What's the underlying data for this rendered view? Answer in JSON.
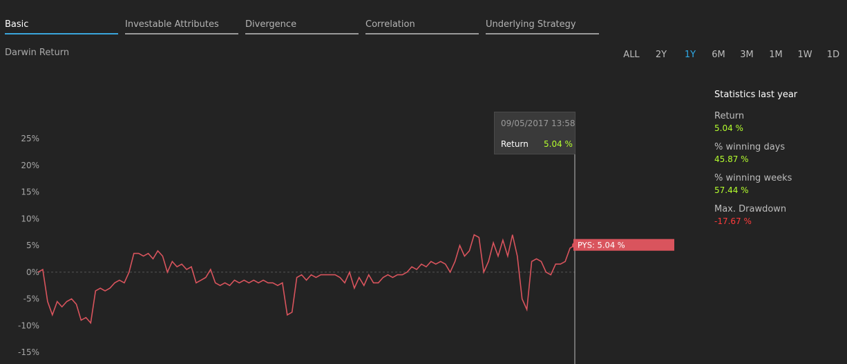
{
  "tabs": [
    {
      "label": "Basic",
      "active": true
    },
    {
      "label": "Investable Attributes",
      "active": false
    },
    {
      "label": "Divergence",
      "active": false
    },
    {
      "label": "Correlation",
      "active": false
    },
    {
      "label": "Underlying Strategy",
      "active": false
    }
  ],
  "section_title": "Darwin Return",
  "periods": [
    {
      "label": "ALL",
      "active": false
    },
    {
      "label": "2Y",
      "active": false
    },
    {
      "label": "1Y",
      "active": true
    },
    {
      "label": "6M",
      "active": false
    },
    {
      "label": "3M",
      "active": false
    },
    {
      "label": "1M",
      "active": false
    },
    {
      "label": "1W",
      "active": false
    },
    {
      "label": "1D",
      "active": false
    }
  ],
  "tooltip": {
    "date": "09/05/2017 13:58",
    "label": "Return",
    "value": "5.04 %"
  },
  "stats": {
    "title": "Statistics last year",
    "items": [
      {
        "label": "Return",
        "value": "5.04 %",
        "sign": "pos"
      },
      {
        "label": "% winning days",
        "value": "45.87 %",
        "sign": "pos"
      },
      {
        "label": "% winning weeks",
        "value": "57.44 %",
        "sign": "pos"
      },
      {
        "label": "Max. Drawdown",
        "value": "-17.67 %",
        "sign": "neg"
      }
    ]
  },
  "colors": {
    "line": "#d9545d",
    "accent": "#2fa9e6",
    "positive": "#b5ff2e",
    "negative": "#ff3b3b"
  },
  "chart_data": {
    "type": "line",
    "ylabel_ticks": [
      "25%",
      "20%",
      "15%",
      "10%",
      "5%",
      "0%",
      "-5%",
      "-10%",
      "-15%"
    ],
    "ylim": [
      -15,
      25
    ],
    "end_label": "PYS: 5.04 %",
    "series": [
      {
        "values": [
          0,
          0.5,
          -5.5,
          -8,
          -5.5,
          -6.5,
          -5.5,
          -5.0,
          -6,
          -9,
          -8.5,
          -9.5,
          -3.5,
          -3,
          -3.5,
          -3.0,
          -2,
          -1.5,
          -2,
          0,
          3.5,
          3.5,
          3,
          3.5,
          2.5,
          4,
          3,
          0,
          2.0,
          1,
          1.5,
          0.5,
          1,
          -2,
          -1.5,
          -1,
          0.5,
          -2,
          -2.5,
          -2,
          -2.5,
          -1.5,
          -2,
          -1.5,
          -2,
          -1.5,
          -2,
          -1.5,
          -2.0,
          -2,
          -2.5,
          -2,
          -8,
          -7.5,
          -1,
          -0.5,
          -1.5,
          -0.5,
          -1,
          -0.5,
          -0.5,
          -0.5,
          -0.5,
          -1,
          -2,
          0,
          -3,
          -1,
          -2.5,
          -0.5,
          -2,
          -2,
          -1,
          -0.5,
          -1,
          -0.5,
          -0.5,
          0,
          1,
          0.5,
          1.5,
          1,
          2,
          1.5,
          2,
          1.5,
          0,
          2,
          5,
          3,
          4,
          7,
          6.5,
          0,
          2,
          5.5,
          3,
          6,
          3,
          7,
          3,
          -5,
          -7,
          2,
          2.5,
          2,
          0,
          -0.5,
          1.5,
          1.5,
          2,
          4.5,
          5.04
        ]
      }
    ]
  }
}
